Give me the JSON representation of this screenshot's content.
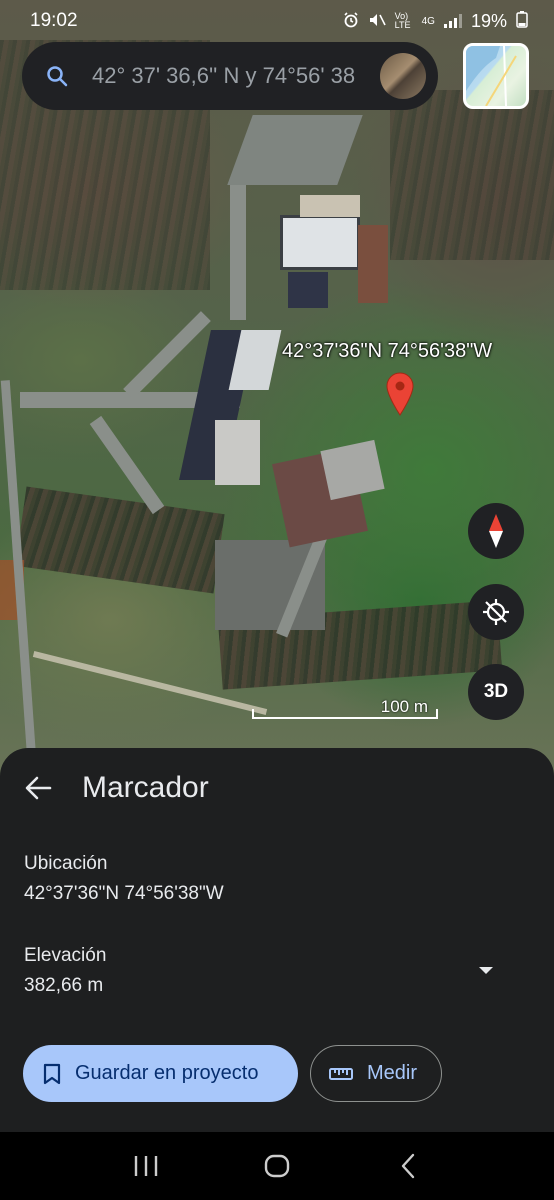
{
  "status_bar": {
    "time": "19:02",
    "network": "4G",
    "volte": "Vo) LTE",
    "battery": "19%",
    "icons": [
      "alarm-icon",
      "mute-icon",
      "signal-icon",
      "battery-icon"
    ]
  },
  "search": {
    "query": "42° 37' 36,6'' N y 74°56' 38",
    "icon": "search-icon"
  },
  "map": {
    "marker_label": "42°37'36\"N 74°56'38\"W",
    "scale_label": "100 m",
    "controls": {
      "compass": "compass-icon",
      "location": "gps-off-icon",
      "three_d": "3D"
    },
    "colors": {
      "pin": "#ea4335"
    }
  },
  "sheet": {
    "title": "Marcador",
    "location_label": "Ubicación",
    "location_value": "42°37'36\"N 74°56'38\"W",
    "elevation_label": "Elevación",
    "elevation_value": "382,66 m",
    "save_button": "Guardar en proyecto",
    "measure_button": "Medir",
    "colors": {
      "primary": "#a8c7fa",
      "surface": "#1e1f20"
    }
  }
}
